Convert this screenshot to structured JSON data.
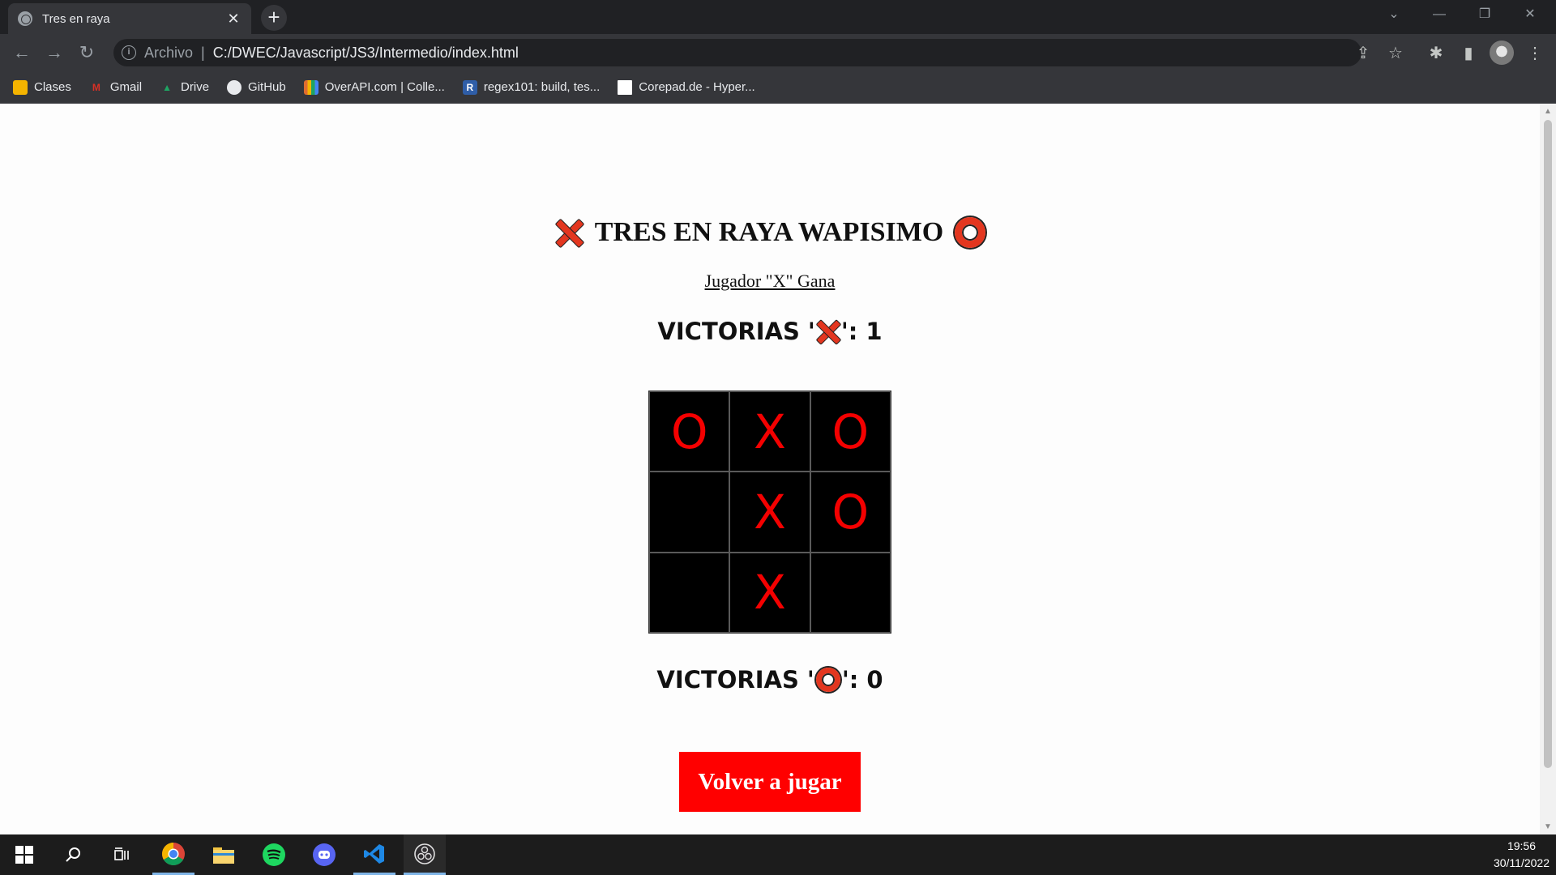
{
  "browser": {
    "tab_title": "Tres en raya",
    "tab_close": "✕",
    "new_tab": "+",
    "address_scheme": "Archivo",
    "address_separator": "|",
    "url": "C:/DWEC/Javascript/JS3/Intermedio/index.html",
    "window_controls": [
      "⌄",
      "—",
      "❐",
      "✕"
    ],
    "nav": {
      "back": "←",
      "forward": "→",
      "reload": "↻"
    },
    "toolbar_icons": {
      "share": "⇪",
      "star": "☆",
      "extensions": "✱",
      "sidepanel": "▮",
      "menu": "⋮"
    }
  },
  "bookmarks": [
    {
      "label": "Clases",
      "icon": "classroom-icon",
      "color": "#f4b400",
      "glyph": ""
    },
    {
      "label": "Gmail",
      "icon": "gmail-icon",
      "color": "#d93025",
      "glyph": "M"
    },
    {
      "label": "Drive",
      "icon": "drive-icon",
      "color": "#1fa463",
      "glyph": "▲"
    },
    {
      "label": "GitHub",
      "icon": "github-icon",
      "color": "#e8eaed",
      "glyph": ""
    },
    {
      "label": "OverAPI.com | Colle...",
      "icon": "overapi-icon",
      "color": "#e06c2f",
      "glyph": ""
    },
    {
      "label": "regex101: build, tes...",
      "icon": "regex101-icon",
      "color": "#2f5ea8",
      "glyph": "R"
    },
    {
      "label": "Corepad.de - Hyper...",
      "icon": "corepad-icon",
      "color": "#ffffff",
      "glyph": ""
    }
  ],
  "game": {
    "title": "TRES EN RAYA WAPISIMO",
    "status": "Jugador \"X\" Gana",
    "wins_x_prefix": "VICTORIAS '",
    "wins_x_suffix": "': 1",
    "wins_o_prefix": "VICTORIAS '",
    "wins_o_suffix": "': 0",
    "board": [
      "O",
      "X",
      "O",
      "",
      "X",
      "O",
      "",
      "X",
      ""
    ],
    "replay_button": "Volver a jugar",
    "accent_color": "#ff0000"
  },
  "taskbar": {
    "apps": [
      "windows-start-icon",
      "search-icon",
      "task-view-icon",
      "chrome-icon",
      "file-explorer-icon",
      "spotify-icon",
      "discord-icon",
      "vscode-icon",
      "obs-icon"
    ],
    "time": "19:56",
    "date": "30/11/2022"
  }
}
